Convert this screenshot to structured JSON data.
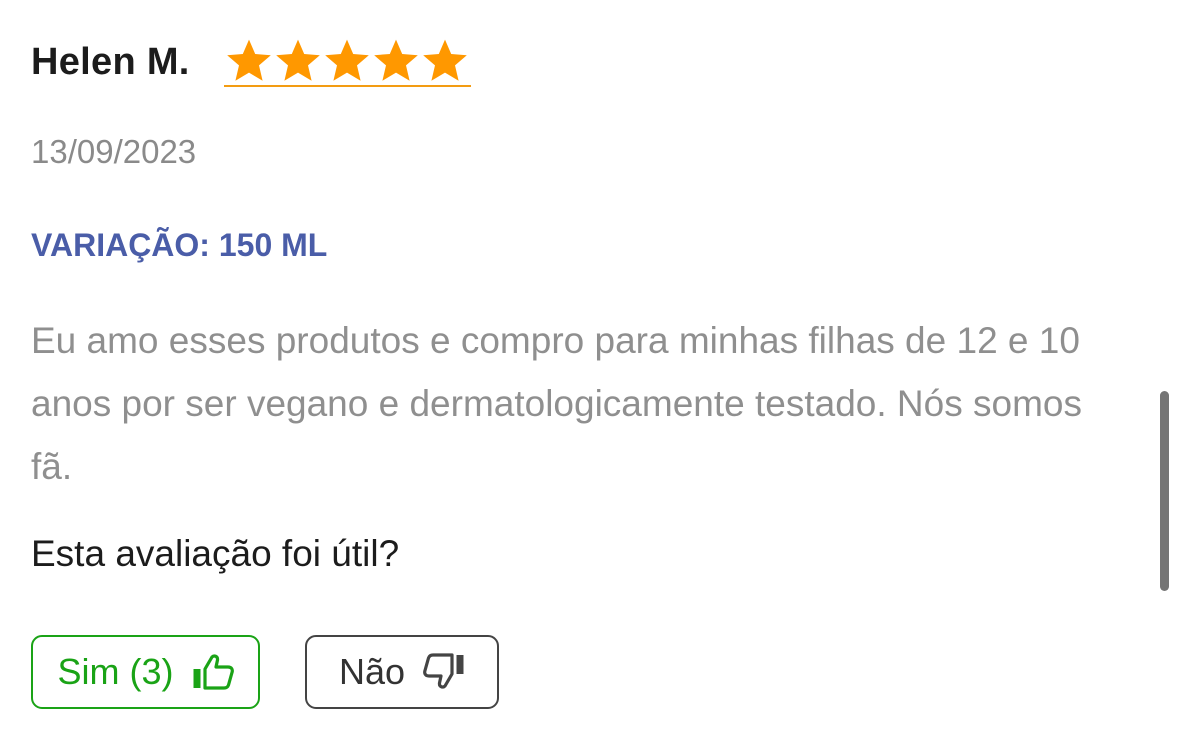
{
  "review": {
    "author": "Helen M.",
    "rating": 5,
    "rating_max": 5,
    "date": "13/09/2023",
    "variation": "VARIAÇÃO: 150 ML",
    "text": "Eu amo esses produtos e compro para minhas filhas de 12 e 10 anos por ser vegano e dermatologicamente testado. Nós somos fã."
  },
  "helpful": {
    "question": "Esta avaliação foi útil?",
    "yes_label": "Sim (3)",
    "no_label": "Não"
  },
  "icons": {
    "star": "star-icon",
    "thumbs_up": "thumbs-up-icon",
    "thumbs_down": "thumbs-down-icon"
  },
  "colors": {
    "star": "#FF9800",
    "variation": "#4A5DA8",
    "yes": "#1AA316",
    "no_border": "#444444"
  }
}
